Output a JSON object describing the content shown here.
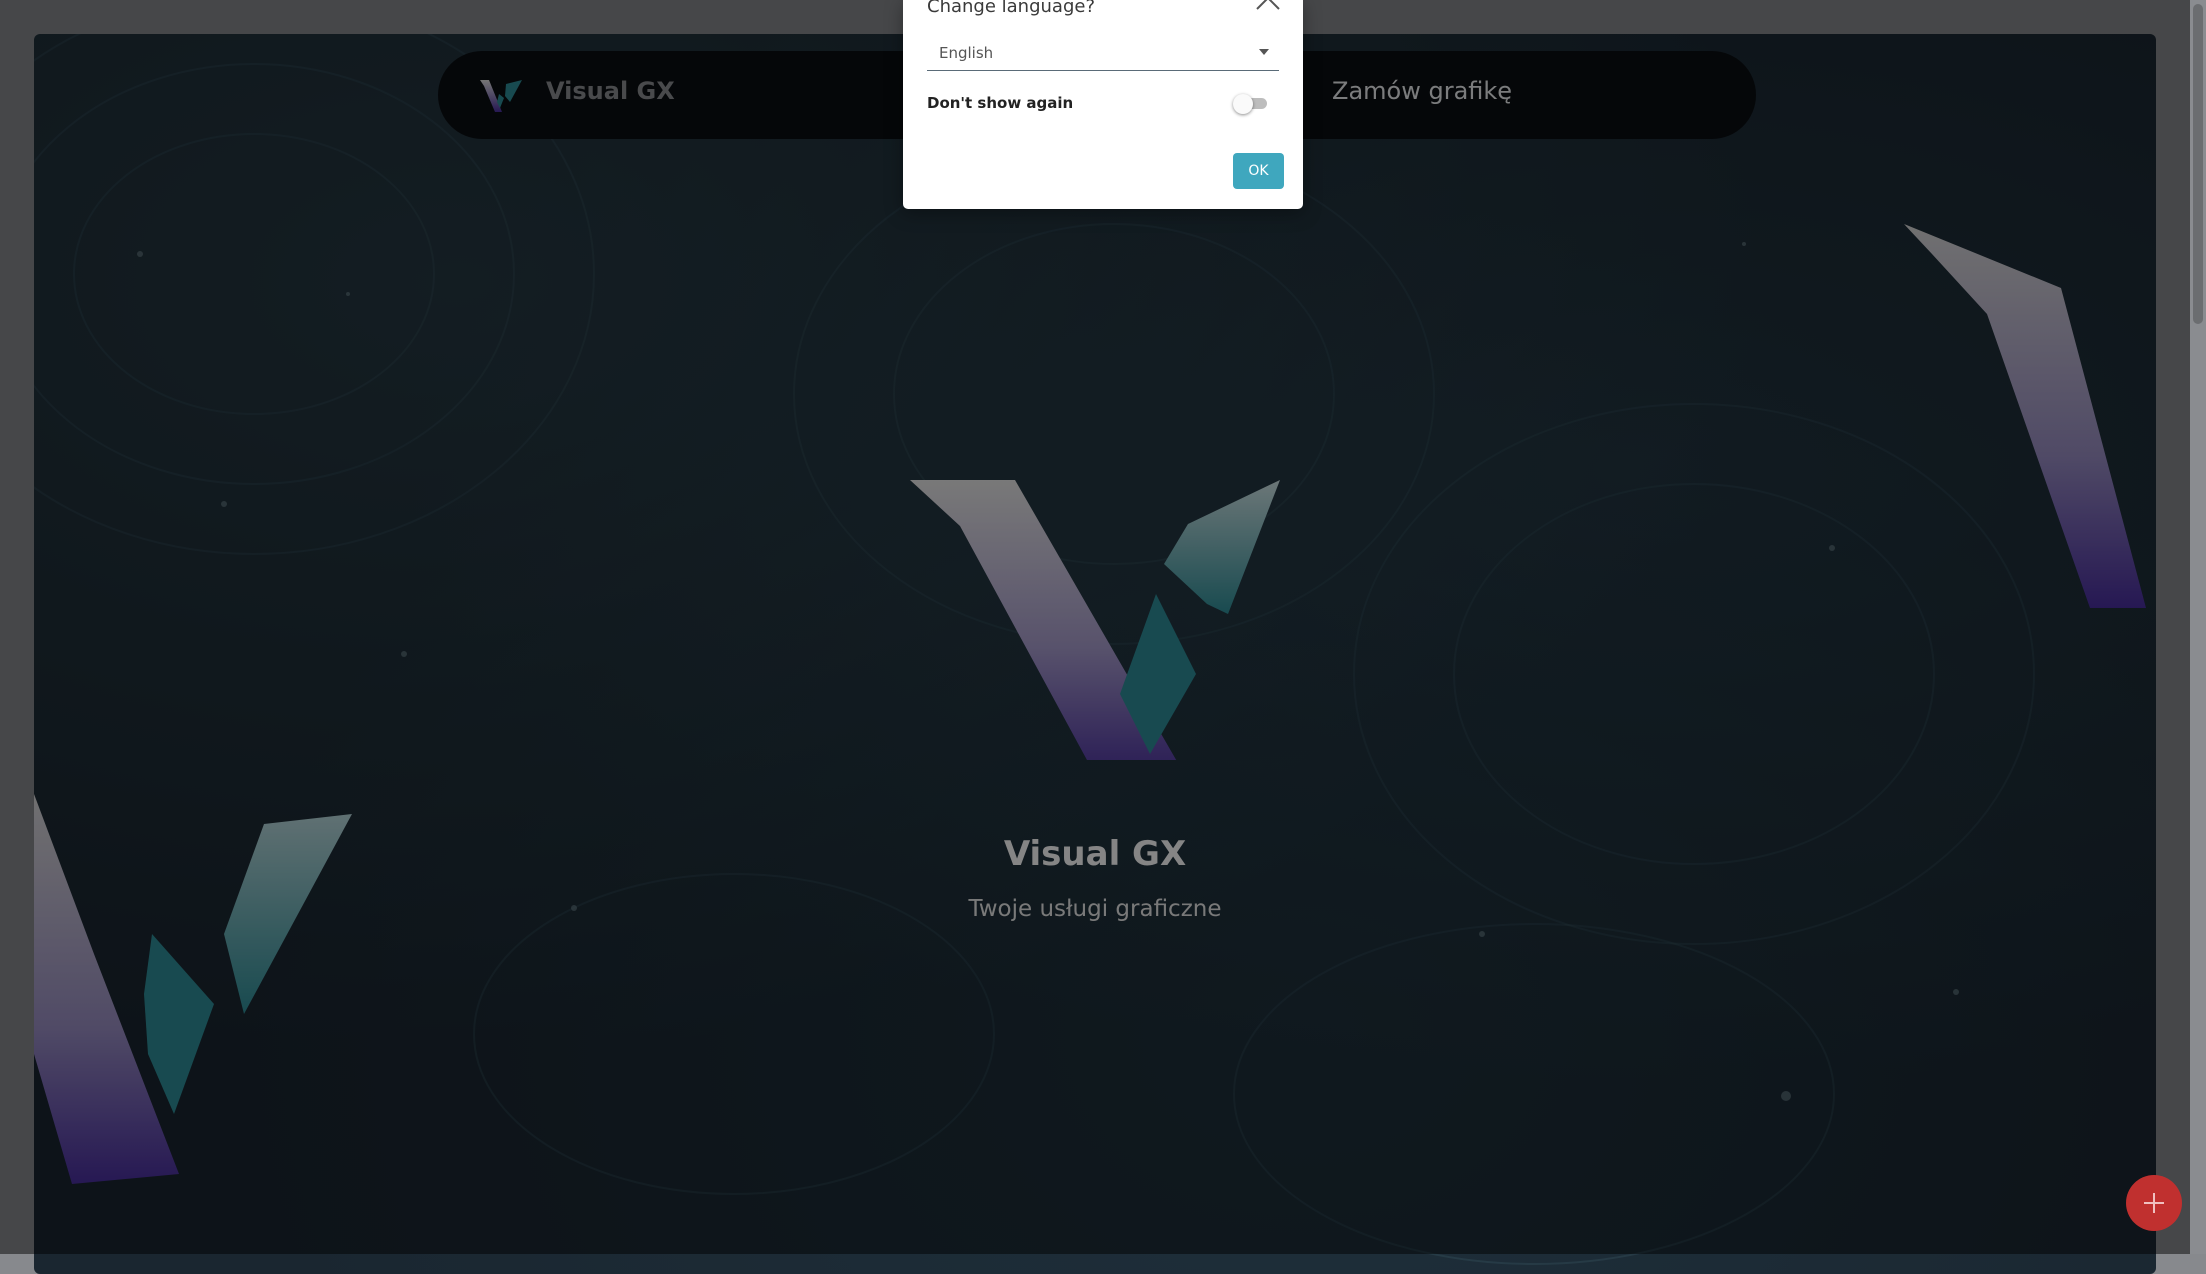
{
  "navbar": {
    "brand": "Visual GX",
    "link_order": "Zamów grafikę"
  },
  "hero": {
    "title": "Visual GX",
    "subtitle": "Twoje usługi graficzne"
  },
  "modal": {
    "title": "Change language?",
    "language_value": "English",
    "dont_show_label": "Don't show again",
    "dont_show_checked": false,
    "ok_label": "OK"
  },
  "colors": {
    "accent": "#3fa7be",
    "fab": "#c0302f",
    "logo_teal": "#2f8f99",
    "logo_purple": "#4a2fa0"
  },
  "icons": {
    "close": "chevron-up-icon",
    "fab": "plus-icon",
    "select": "caret-down-icon"
  }
}
